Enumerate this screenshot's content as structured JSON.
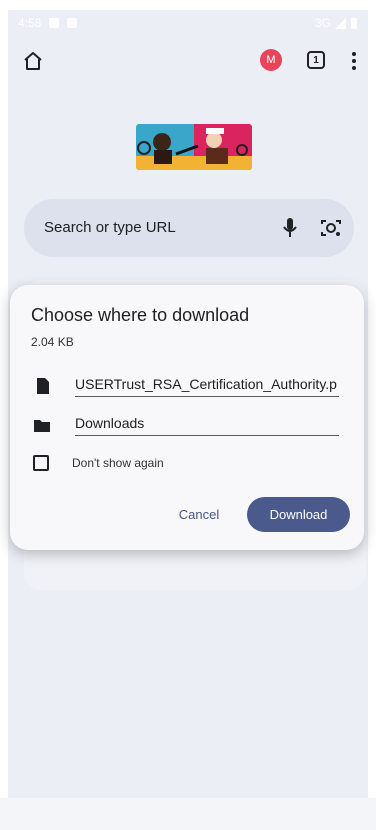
{
  "status_bar": {
    "time": "4:58",
    "network": "3G"
  },
  "toolbar": {
    "avatar_letter": "M",
    "tab_count": "1"
  },
  "search": {
    "placeholder": "Search or type URL"
  },
  "dialog": {
    "title": "Choose where to download",
    "file_size": "2.04 KB",
    "file_name": "USERTrust_RSA_Certification_Authority.p",
    "location": "Downloads",
    "checkbox_label": "Don't show again",
    "checkbox_checked": false,
    "cancel_label": "Cancel",
    "download_label": "Download"
  },
  "colors": {
    "accent": "#4b5a8c",
    "avatar": "#e8455a",
    "background": "#eceef6"
  }
}
